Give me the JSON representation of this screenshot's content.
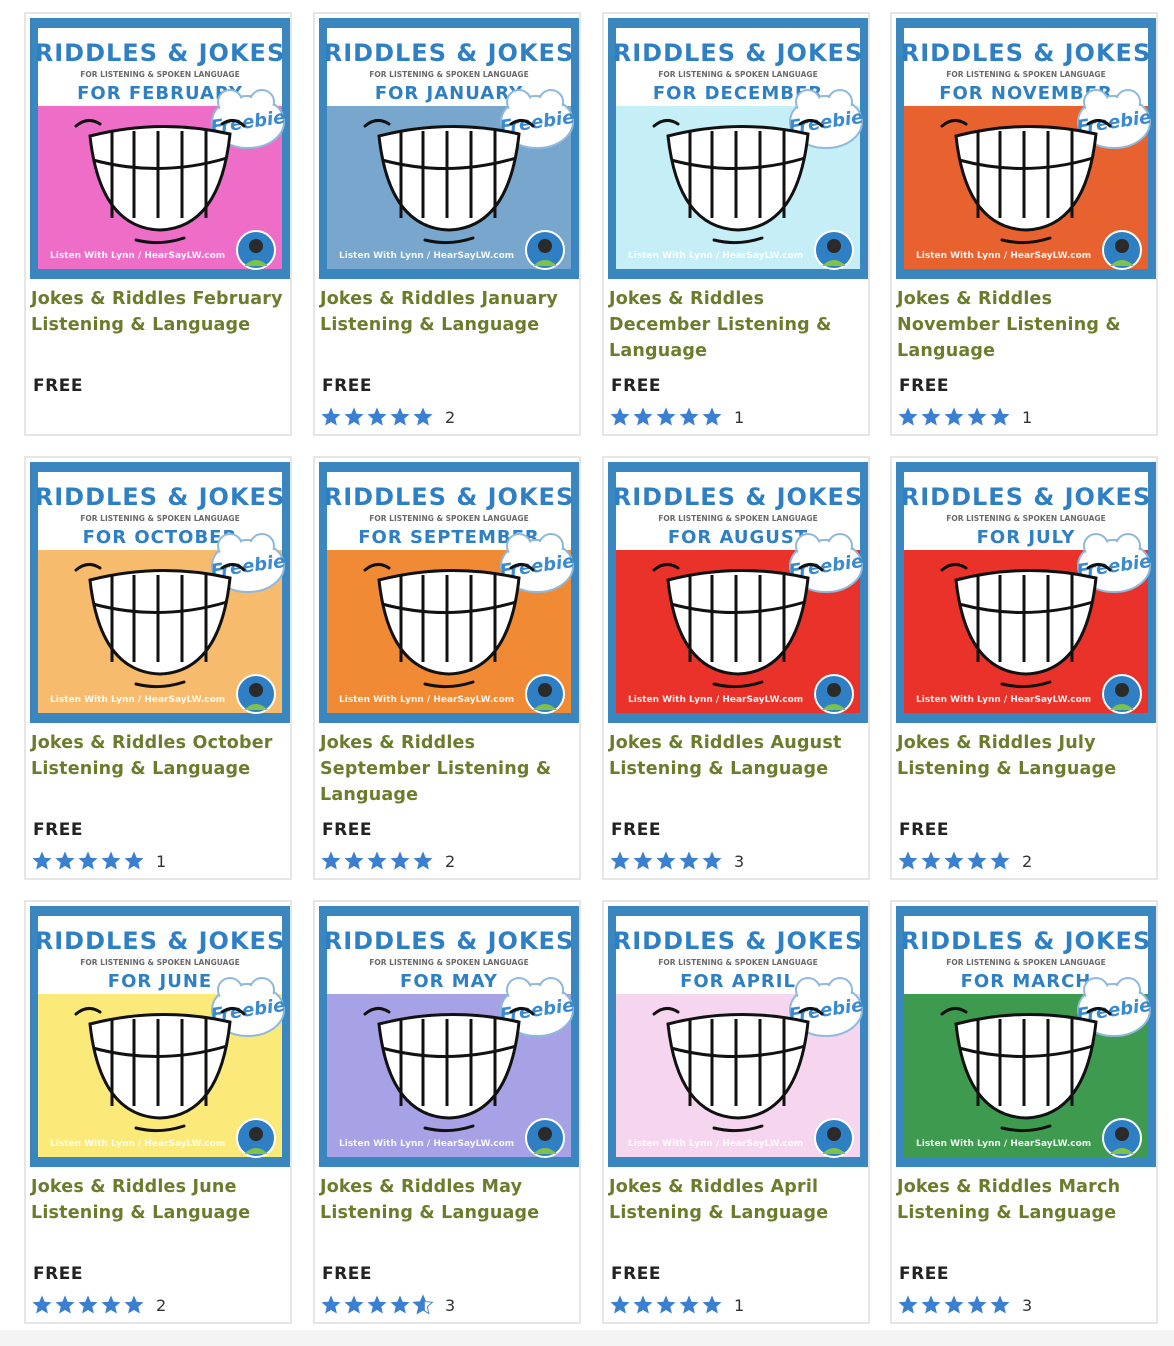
{
  "products": [
    {
      "thumb": {
        "header": "RIDDLES & JOKES",
        "sub": "FOR LISTENING & SPOKEN LANGUAGE",
        "month": "FOR FEBRUARY",
        "badge": "Freebie",
        "footer": "Listen With Lynn / HearSayLW.com",
        "bg": "#ee6ec7",
        "frame": "#3a87c0"
      },
      "title_lines": [
        "Jokes & Riddles February",
        "Listening & Language"
      ],
      "price": "FREE",
      "rating": null,
      "rating_count": null
    },
    {
      "thumb": {
        "header": "RIDDLES & JOKES",
        "sub": "FOR LISTENING & SPOKEN LANGUAGE",
        "month": "FOR JANUARY",
        "badge": "Freebie",
        "footer": "Listen With Lynn / HearSayLW.com",
        "bg": "#78a6cc",
        "frame": "#3a87c0"
      },
      "title_lines": [
        "Jokes & Riddles January",
        "Listening & Language"
      ],
      "price": "FREE",
      "rating": 5,
      "rating_count": "2"
    },
    {
      "thumb": {
        "header": "RIDDLES & JOKES",
        "sub": "FOR LISTENING & SPOKEN LANGUAGE",
        "month": "FOR DECEMBER",
        "badge": "Freebie",
        "footer": "Listen With Lynn / HearSayLW.com",
        "bg": "#c6eef6",
        "frame": "#3a87c0"
      },
      "title_lines": [
        "Jokes & Riddles",
        "December Listening &",
        "Language"
      ],
      "price": "FREE",
      "rating": 5,
      "rating_count": "1"
    },
    {
      "thumb": {
        "header": "RIDDLES & JOKES",
        "sub": "FOR LISTENING & SPOKEN LANGUAGE",
        "month": "FOR NOVEMBER",
        "badge": "Freebie",
        "footer": "Listen With Lynn / HearSayLW.com",
        "bg": "#e7622f",
        "frame": "#3a87c0"
      },
      "title_lines": [
        "Jokes & Riddles",
        "November Listening &",
        "Language"
      ],
      "price": "FREE",
      "rating": 5,
      "rating_count": "1"
    },
    {
      "thumb": {
        "header": "RIDDLES & JOKES",
        "sub": "FOR LISTENING & SPOKEN LANGUAGE",
        "month": "FOR OCTOBER",
        "badge": "Freebie",
        "footer": "Listen With Lynn / HearSayLW.com",
        "bg": "#f6bb6c",
        "frame": "#3a87c0"
      },
      "title_lines": [
        "Jokes & Riddles October",
        "Listening & Language"
      ],
      "price": "FREE",
      "rating": 5,
      "rating_count": "1"
    },
    {
      "thumb": {
        "header": "RIDDLES & JOKES",
        "sub": "FOR LISTENING & SPOKEN LANGUAGE",
        "month": "FOR SEPTEMBER",
        "badge": "Freebie",
        "footer": "Listen With Lynn / HearSayLW.com",
        "bg": "#f08a34",
        "frame": "#3a87c0"
      },
      "title_lines": [
        "Jokes & Riddles",
        "September Listening &",
        "Language"
      ],
      "price": "FREE",
      "rating": 5,
      "rating_count": "2"
    },
    {
      "thumb": {
        "header": "RIDDLES & JOKES",
        "sub": "FOR LISTENING & SPOKEN LANGUAGE",
        "month": "FOR AUGUST",
        "badge": "Freebie",
        "footer": "Listen With Lynn / HearSayLW.com",
        "bg": "#e8322a",
        "frame": "#3a87c0"
      },
      "title_lines": [
        "Jokes & Riddles August",
        "Listening & Language"
      ],
      "price": "FREE",
      "rating": 5,
      "rating_count": "3"
    },
    {
      "thumb": {
        "header": "RIDDLES & JOKES",
        "sub": "FOR LISTENING & SPOKEN LANGUAGE",
        "month": "FOR JULY",
        "badge": "Freebie",
        "footer": "Listen With Lynn / HearSayLW.com",
        "bg": "#e8322a",
        "frame": "#3a87c0"
      },
      "title_lines": [
        "Jokes & Riddles July",
        "Listening & Language"
      ],
      "price": "FREE",
      "rating": 5,
      "rating_count": "2"
    },
    {
      "thumb": {
        "header": "RIDDLES & JOKES",
        "sub": "FOR LISTENING & SPOKEN LANGUAGE",
        "month": "FOR JUNE",
        "badge": "Freebie",
        "footer": "Listen With Lynn / HearSayLW.com",
        "bg": "#fbe97a",
        "frame": "#3a87c0"
      },
      "title_lines": [
        "Jokes & Riddles June",
        "Listening & Language"
      ],
      "price": "FREE",
      "rating": 5,
      "rating_count": "2"
    },
    {
      "thumb": {
        "header": "RIDDLES & JOKES",
        "sub": "FOR LISTENING & SPOKEN LANGUAGE",
        "month": "FOR MAY",
        "badge": "Freebie",
        "footer": "Listen With Lynn / HearSayLW.com",
        "bg": "#a7a1e6",
        "frame": "#3a87c0"
      },
      "title_lines": [
        "Jokes & Riddles May",
        "Listening & Language"
      ],
      "price": "FREE",
      "rating": 4.5,
      "rating_count": "3"
    },
    {
      "thumb": {
        "header": "RIDDLES & JOKES",
        "sub": "FOR LISTENING & SPOKEN LANGUAGE",
        "month": "FOR APRIL",
        "badge": "Freebie",
        "footer": "Listen With Lynn / HearSayLW.com",
        "bg": "#f6d5ee",
        "frame": "#3a87c0"
      },
      "title_lines": [
        "Jokes & Riddles April",
        "Listening & Language"
      ],
      "price": "FREE",
      "rating": 5,
      "rating_count": "1"
    },
    {
      "thumb": {
        "header": "RIDDLES & JOKES",
        "sub": "FOR LISTENING & SPOKEN LANGUAGE",
        "month": "FOR MARCH",
        "badge": "Freebie",
        "footer": "Listen With Lynn / HearSayLW.com",
        "bg": "#3e9a4f",
        "frame": "#3a87c0"
      },
      "title_lines": [
        "Jokes & Riddles March",
        "Listening & Language"
      ],
      "price": "FREE",
      "rating": 5,
      "rating_count": "3"
    }
  ],
  "colors": {
    "title": "#6b7d2c",
    "star": "#3b7fd0",
    "header_text": "#2f7fc4",
    "card_border": "#e6e6e6"
  },
  "icons": {
    "star": "star-icon",
    "half_star": "star-half-icon",
    "smile": "smile-illustration",
    "avatar": "avatar-logo"
  }
}
